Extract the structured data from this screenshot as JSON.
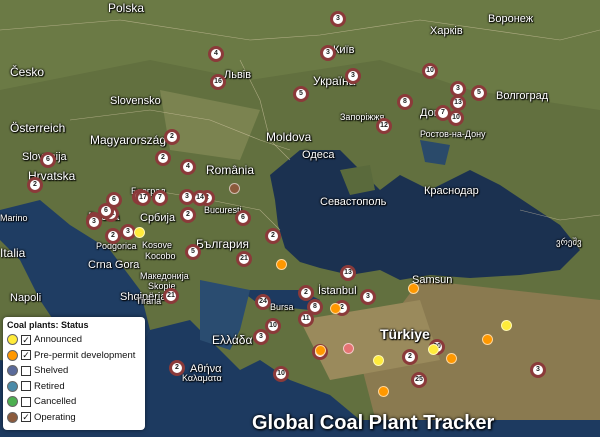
{
  "legend": {
    "title": "Coal plants: Status",
    "items": [
      {
        "label": "Announced",
        "color": "#ffeb3b",
        "checked": true
      },
      {
        "label": "Pre-permit development",
        "color": "#ff9800",
        "checked": true
      },
      {
        "label": "Shelved",
        "color": "#5a6a9a",
        "checked": false
      },
      {
        "label": "Retired",
        "color": "#4a8aa8",
        "checked": false
      },
      {
        "label": "Cancelled",
        "color": "#4caf50",
        "checked": false
      },
      {
        "label": "Operating",
        "color": "#8b5a3c",
        "checked": true
      }
    ]
  },
  "watermark": "Global Coal Plant Tracker",
  "labels": [
    {
      "text": "Polska",
      "cls": "country"
    },
    {
      "text": "Česko",
      "cls": "country"
    },
    {
      "text": "Slovensko",
      "cls": ""
    },
    {
      "text": "Österreich",
      "cls": "country"
    },
    {
      "text": "Magyarország",
      "cls": "country"
    },
    {
      "text": "Slovenija",
      "cls": ""
    },
    {
      "text": "Hrvatska",
      "cls": "country"
    },
    {
      "text": "Bosna",
      "cls": ""
    },
    {
      "text": "Србија",
      "cls": ""
    },
    {
      "text": "Crna Gora",
      "cls": ""
    },
    {
      "text": "Kosove",
      "cls": "small"
    },
    {
      "text": "Shqipëria",
      "cls": ""
    },
    {
      "text": "Македонија",
      "cls": "small"
    },
    {
      "text": "România",
      "cls": "country"
    },
    {
      "text": "Moldova",
      "cls": "country"
    },
    {
      "text": "България",
      "cls": "country"
    },
    {
      "text": "Україна",
      "cls": "country"
    },
    {
      "text": "Київ",
      "cls": ""
    },
    {
      "text": "Львів",
      "cls": ""
    },
    {
      "text": "Харків",
      "cls": ""
    },
    {
      "text": "Запоріжжя",
      "cls": "small"
    },
    {
      "text": "Доне",
      "cls": ""
    },
    {
      "text": "Ростов-на-Дону",
      "cls": "small"
    },
    {
      "text": "Волгоград",
      "cls": ""
    },
    {
      "text": "Воронеж",
      "cls": ""
    },
    {
      "text": "Одеса",
      "cls": ""
    },
    {
      "text": "Краснодар",
      "cls": ""
    },
    {
      "text": "Севастополь",
      "cls": ""
    },
    {
      "text": "Türkiye",
      "cls": "big"
    },
    {
      "text": "Samsun",
      "cls": ""
    },
    {
      "text": "Bursa",
      "cls": "small"
    },
    {
      "text": "İstanbul",
      "cls": ""
    },
    {
      "text": "Ελλάδα",
      "cls": "country"
    },
    {
      "text": "Αθήνα",
      "cls": ""
    },
    {
      "text": "Καλαματα",
      "cls": "small"
    },
    {
      "text": "Napoli",
      "cls": ""
    },
    {
      "text": "Italia",
      "cls": "country"
    },
    {
      "text": "Marino",
      "cls": "small"
    },
    {
      "text": "Bucuresti",
      "cls": "small"
    },
    {
      "text": "Београд",
      "cls": "small"
    },
    {
      "text": "Skopje",
      "cls": "small"
    },
    {
      "text": "Kocobo",
      "cls": "small"
    },
    {
      "text": "Tirana",
      "cls": "small"
    },
    {
      "text": "Podgorica",
      "cls": "small"
    },
    {
      "text": "ვრეშვ",
      "cls": "small"
    }
  ],
  "markers": [
    {
      "n": "3"
    },
    {
      "n": "4"
    },
    {
      "n": "3"
    },
    {
      "n": "16"
    },
    {
      "n": "3"
    },
    {
      "n": "5"
    },
    {
      "n": "10"
    },
    {
      "n": "3"
    },
    {
      "n": "13"
    },
    {
      "n": "5"
    },
    {
      "n": "7"
    },
    {
      "n": "10"
    },
    {
      "n": "8"
    },
    {
      "n": "12"
    },
    {
      "n": "2"
    },
    {
      "n": "6"
    },
    {
      "n": "2"
    },
    {
      "n": "4"
    },
    {
      "n": "2"
    },
    {
      "n": "6"
    },
    {
      "n": "2"
    },
    {
      "n": "3"
    },
    {
      "n": "2"
    },
    {
      "n": "11"
    },
    {
      "n": "17"
    },
    {
      "n": "7"
    },
    {
      "n": "3"
    },
    {
      "n": "14"
    },
    {
      "n": "2"
    },
    {
      "n": "6"
    },
    {
      "n": "3"
    },
    {
      "n": "6"
    },
    {
      "n": "3"
    },
    {
      "n": "2"
    },
    {
      "n": "5"
    },
    {
      "n": "2"
    },
    {
      "n": "21"
    },
    {
      "n": "21"
    },
    {
      "n": "24"
    },
    {
      "n": "13"
    },
    {
      "n": "2"
    },
    {
      "n": "8"
    },
    {
      "n": "3"
    },
    {
      "n": "2"
    },
    {
      "n": "11"
    },
    {
      "n": "10"
    },
    {
      "n": "2"
    },
    {
      "n": "3"
    },
    {
      "n": "2"
    },
    {
      "n": "20"
    },
    {
      "n": "25"
    },
    {
      "n": "3"
    },
    {
      "n": "10"
    },
    {
      "n": "2"
    }
  ],
  "dots": [
    {
      "color": "#ffeb3b"
    },
    {
      "color": "#ffeb3b"
    },
    {
      "color": "#ff9800"
    },
    {
      "color": "#ff9800"
    },
    {
      "color": "#ffeb3b"
    },
    {
      "color": "#ff9800"
    },
    {
      "color": "#ff9800"
    },
    {
      "color": "#ffeb3b"
    },
    {
      "color": "#e57373"
    },
    {
      "color": "#ff9800"
    },
    {
      "color": "#ff9800"
    },
    {
      "color": "#8b5a3c"
    },
    {
      "color": "#ff9800"
    }
  ]
}
